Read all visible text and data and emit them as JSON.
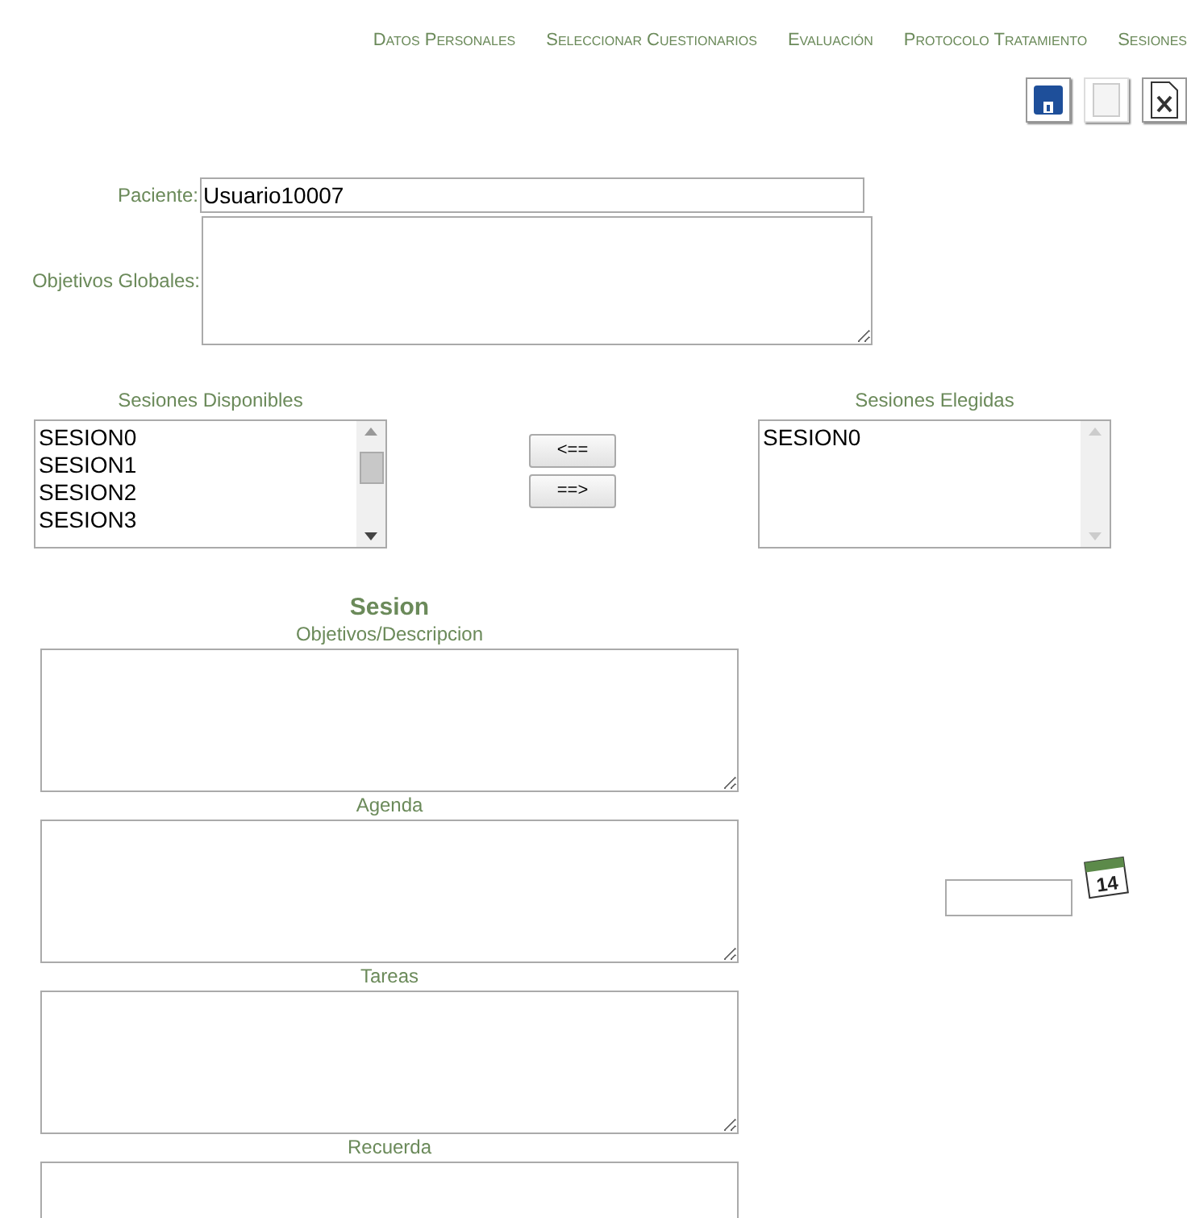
{
  "nav": [
    {
      "label": "Datos Personales"
    },
    {
      "label": "Seleccionar Cuestionarios"
    },
    {
      "label": "Evaluación"
    },
    {
      "label": "Protocolo Tratamiento"
    },
    {
      "label": "Sesiones"
    }
  ],
  "toolbar": [
    {
      "kind": "save",
      "disabled": false
    },
    {
      "kind": "blank",
      "disabled": true
    },
    {
      "kind": "excel",
      "disabled": false
    }
  ],
  "patient": {
    "label": "Paciente:",
    "value": "Usuario10007"
  },
  "global_objectives": {
    "label": "Objetivos Globales:"
  },
  "available": {
    "label": "Sesiones Disponibles",
    "items": [
      {
        "label": "SESION0"
      },
      {
        "label": "SESION1"
      },
      {
        "label": "SESION2"
      },
      {
        "label": "SESION3"
      }
    ]
  },
  "move_buttons": [
    {
      "label": "<=="
    },
    {
      "label": "==>"
    }
  ],
  "chosen": {
    "label": "Sesiones Elegidas",
    "items": [
      {
        "label": "SESION0"
      }
    ]
  },
  "session": {
    "title": "Sesion",
    "fields": [
      {
        "label": "Objetivos/Descripcion"
      },
      {
        "label": "Agenda"
      },
      {
        "label": "Tareas"
      },
      {
        "label": "Recuerda"
      }
    ]
  },
  "date": {
    "calendar_day": "14"
  }
}
